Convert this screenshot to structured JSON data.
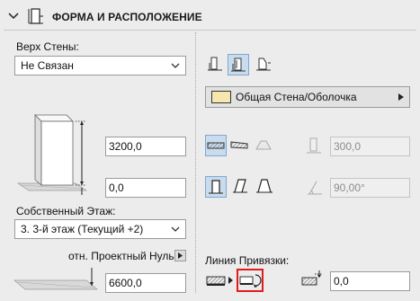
{
  "header": {
    "title": "ФОРМА И РАСПОЛОЖЕНИЕ"
  },
  "left": {
    "top_wall_label": "Верх Стены:",
    "top_wall_value": "Не Связан",
    "height_value": "3200,0",
    "offset_value": "0,0",
    "home_story_label": "Собственный Этаж:",
    "home_story_value": "3. 3-й этаж (Текущий +2)",
    "reference_label": "отн. Проектный Нуль",
    "elevation_value": "6600,0"
  },
  "right": {
    "composite_value": "Общая Стена/Оболочка",
    "thickness_value": "300,0",
    "angle_value": "90,00°",
    "reference_line_label": "Линия Привязки:",
    "ref_offset_value": "0,0"
  },
  "icons": {
    "collapse": "chevron-down-icon",
    "section": "wall-form-icon"
  },
  "colors": {
    "selected_bg": "#c9dcee",
    "highlight_border": "#e11b1b"
  }
}
